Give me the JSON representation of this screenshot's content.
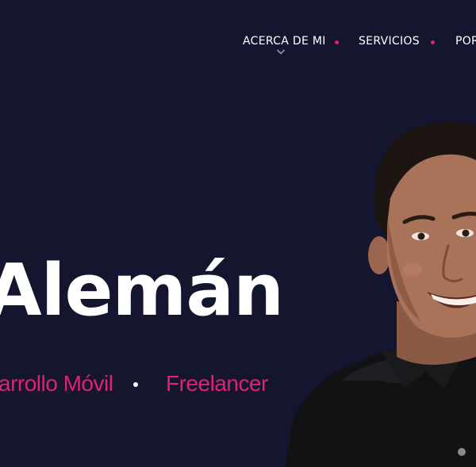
{
  "nav": {
    "items": [
      {
        "label": "ACERCA DE MI"
      },
      {
        "label": "SERVICIOS"
      },
      {
        "label": "POR"
      }
    ]
  },
  "hero": {
    "name": "Alemán",
    "roles": [
      "arrollo Móvil",
      "Freelancer"
    ]
  },
  "colors": {
    "background": "#14152f",
    "accent": "#e0207a",
    "text": "#ffffff"
  },
  "icons": {
    "active_indicator": "chevron-down-icon"
  }
}
